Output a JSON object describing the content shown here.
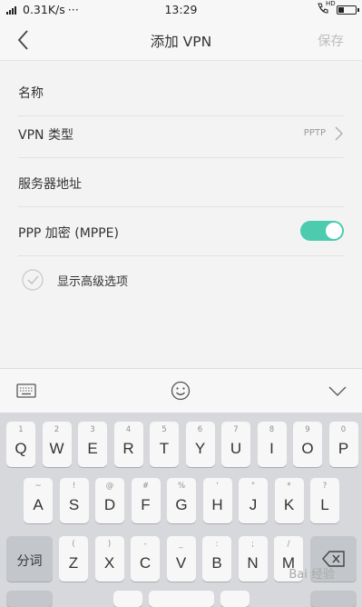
{
  "status_bar": {
    "network_speed": "0.31K/s",
    "more": "···",
    "time": "13:29",
    "hd_label": "HD",
    "battery_level": 0.35
  },
  "header": {
    "title": "添加 VPN",
    "save_label": "保存"
  },
  "form": {
    "name_label": "名称",
    "vpn_type_label": "VPN 类型",
    "vpn_type_value": "PPTP",
    "server_label": "服务器地址",
    "ppp_label": "PPP 加密 (MPPE)",
    "ppp_enabled": true,
    "advanced_label": "显示高级选项",
    "accent_color": "#4ccbaf"
  },
  "keyboard": {
    "row1": [
      {
        "sub": "1",
        "main": "Q"
      },
      {
        "sub": "2",
        "main": "W"
      },
      {
        "sub": "3",
        "main": "E"
      },
      {
        "sub": "4",
        "main": "R"
      },
      {
        "sub": "5",
        "main": "T"
      },
      {
        "sub": "6",
        "main": "Y"
      },
      {
        "sub": "7",
        "main": "U"
      },
      {
        "sub": "8",
        "main": "I"
      },
      {
        "sub": "9",
        "main": "O"
      },
      {
        "sub": "0",
        "main": "P"
      }
    ],
    "row2": [
      {
        "sub": "~",
        "main": "A"
      },
      {
        "sub": "!",
        "main": "S"
      },
      {
        "sub": "@",
        "main": "D"
      },
      {
        "sub": "#",
        "main": "F"
      },
      {
        "sub": "%",
        "main": "G"
      },
      {
        "sub": "'",
        "main": "H"
      },
      {
        "sub": "\"",
        "main": "J"
      },
      {
        "sub": "*",
        "main": "K"
      },
      {
        "sub": "?",
        "main": "L"
      }
    ],
    "row3": [
      {
        "sub": "(",
        "main": "Z"
      },
      {
        "sub": ")",
        "main": "X"
      },
      {
        "sub": "-",
        "main": "C"
      },
      {
        "sub": "_",
        "main": "V"
      },
      {
        "sub": ":",
        "main": "B"
      },
      {
        "sub": ";",
        "main": "N"
      },
      {
        "sub": "/",
        "main": "M"
      }
    ],
    "segment_label": "分词",
    "icons": [
      "keyboard-icon",
      "emoji-icon",
      "collapse-chevron-icon",
      "backspace-icon"
    ]
  },
  "watermark": "Bai 经验"
}
